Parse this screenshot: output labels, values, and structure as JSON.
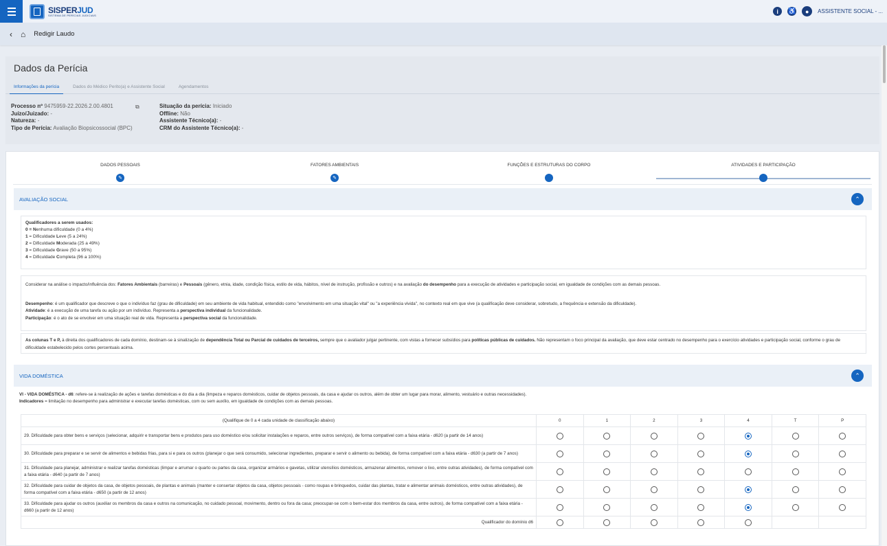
{
  "topbar": {
    "logo_main": "SISPER",
    "logo_accent": "JUD",
    "logo_sub": "SISTEMA DE PERÍCIAS JUDICIAIS",
    "info_icon": "i",
    "accessibility_icon": "accessibility-icon",
    "user_name": "ASSISTENTE SOCIAL - ..."
  },
  "breadcrumb": {
    "back_icon": "‹",
    "home_icon": "home-icon",
    "title": "Redigir Laudo"
  },
  "pericia": {
    "title": "Dados da Perícia",
    "tabs": [
      {
        "label": "Informações da perícia"
      },
      {
        "label": "Dados do Médico Perito(a) e Assistente Social"
      },
      {
        "label": "Agendamentos"
      }
    ],
    "left": {
      "processo_label": "Processo nº",
      "processo_value": "9475959-22.2026.2.00.4801",
      "juizo_label": "Juízo/Juizado:",
      "juizo_value": "-",
      "natureza_label": "Natureza:",
      "natureza_value": "-",
      "tipo_label": "Tipo de Perícia:",
      "tipo_value": "Avaliação Biopsicossocial (BPC)"
    },
    "right": {
      "situacao_label": "Situação da perícia:",
      "situacao_value": "Iniciado",
      "offline_label": "Offline:",
      "offline_value": "Não",
      "assistente_label": "Assistente Técnico(a):",
      "assistente_value": "-",
      "crm_label": "CRM do Assistente Técnico(a):",
      "crm_value": "-"
    }
  },
  "stepper": [
    {
      "label": "DADOS PESSOAIS",
      "icon": "edit-icon"
    },
    {
      "label": "FATORES AMBIENTAIS",
      "icon": "edit-icon"
    },
    {
      "label": "FUNÇÕES E ESTRUTURAS DO CORPO",
      "icon": "dot"
    },
    {
      "label": "ATIVIDADES E PARTICIPAÇÃO",
      "icon": "dot"
    }
  ],
  "avaliacao": {
    "title": "AVALIAÇÃO SOCIAL",
    "qual_head": "Qualificadores a serem usados:",
    "q0_num": "0 =",
    "q0_b": "N",
    "q0_rest": "enhuma dificuldade (0 a 4%)",
    "q1_num": "1",
    "q1_pre": " = Dificuldade ",
    "q1_b": "L",
    "q1_rest": "eve (5 a 24%)",
    "q2_num": "2",
    "q2_pre": " = Dificuldade ",
    "q2_b": "M",
    "q2_rest": "oderada (25 a 49%)",
    "q3_num": "3",
    "q3_pre": " = Dificuldade ",
    "q3_b": "G",
    "q3_rest": "rave (50 a 95%)",
    "q4_num": "4",
    "q4_pre": " = Dificuldade ",
    "q4_b": "C",
    "q4_rest": "ompleta (96 a 100%)",
    "note1_a": "Considerar na análise o impacto/influência dos: ",
    "note1_b1": "Fatores Ambientais",
    "note1_c": " (barreiras) e ",
    "note1_b2": "Pessoais",
    "note1_d": " (gênero, etnia, idade, condição física, estilo de vida, hábitos, nível de instrução, profissão e outros) e na avaliação ",
    "note1_b3": "do desempenho",
    "note1_e": " para a execução de atividades e participação social, em igualdade de condições com as demais pessoas.",
    "desemp_b": "Desempenho",
    "desemp_t": ": é um qualificador que descreve o que o indivíduo faz (grau de dificuldade) em seu ambiente de vida habitual, entendido como \"envolvimento em uma situação vital\" ou \"a experiência vivida\", no contexto real em que vive (a qualificação deve considerar, sobretudo, a frequência e extensão da dificuldade).",
    "ativ_b": "Atividade",
    "ativ_t": ": é a execução de uma tarefa ou ação por um indivíduo. Representa a ",
    "ativ_b2": "perspectiva individual",
    "ativ_t2": " da funcionalidade.",
    "part_b": "Participação",
    "part_t": ": é o ato de se envolver em uma situação real de vida. Representa a ",
    "part_b2": "perspectiva social",
    "part_t2": " da funcionalidade.",
    "col_b": "As colunas T e P,",
    "col_t": " à direita dos qualificadores de cada domínio, destinam-se à sinalização de ",
    "col_b2": "dependência Total ou Parcial de cuidados de terceiros,",
    "col_t2": " sempre que o avaliador julgar pertinente, com vistas a fornecer subsídios para ",
    "col_b3": "políticas públicas de cuidados.",
    "col_t3": " Não representam o foco principal da avaliação, que deve estar centrado no desempenho para o exercício atividades e participação social, conforme o grau de dificuldade estabelecido pelos cortes percentuais acima."
  },
  "vida": {
    "title": "VIDA DOMÉSTICA",
    "desc_b": "VI - VIDA DOMÉSTICA - d6",
    "desc_t": ": refere-se à realização de ações e tarefas domésticas e do dia a dia (limpeza e reparos domésticos, cuidar de objetos pessoais, da casa e ajudar os outros, além de obter um lugar para morar, alimento, vestuário e outras necessidades).",
    "ind_b": "Indicadores",
    "ind_t": " = limitação no desempenho para administrar e executar tarefas domésticas, com ou sem auxílio, em igualdade de condições com as demais pessoas.",
    "table_head": "(Qualifique de 0 a 4 cada unidade de classificação abaixo)",
    "columns": [
      "0",
      "1",
      "2",
      "3",
      "4",
      "T",
      "P"
    ],
    "rows": [
      {
        "text": "29. Dificuldade para obter bens e serviços (selecionar, adquirir e transportar bens e produtos para uso doméstico e/ou solicitar instalações e reparos, entre outros serviços), de forma compatível com a faixa etária - d620 (a partir de 14 anos)",
        "selected": "4"
      },
      {
        "text": "30. Dificuldade para preparar e se servir de alimentos e bebidas frias, para si e para os outros (planejar o que será consumido, selecionar ingredientes, preparar e servir o alimento ou bebida), de forma compatível com a faixa etária - d630 (a partir de 7 anos)",
        "selected": "4"
      },
      {
        "text": "31. Dificuldade para planejar, administrar e realizar tarefas domésticas (limpar e arrumar o quarto ou partes da casa, organizar armários e gavetas, utilizar utensílios domésticos, armazenar alimentos, remover o lixo, entre outras atividades), de forma compatível com a faixa etária - d640 (a partir de 7 anos)",
        "selected": ""
      },
      {
        "text": "32. Dificuldade para cuidar de objetos da casa, de objetos pessoais, de plantas e animais (manter e consertar objetos da casa, objetos pessoais - como roupas e brinquedos, cuidar das plantas, tratar e alimentar animais domésticos, entre outras atividades), de forma compatível com a faixa etária - d650 (a partir de 12 anos)",
        "selected": "4"
      },
      {
        "text": "33. Dificuldade para ajudar os outros (auxiliar os membros da casa e outros na comunicação, no cuidado pessoal, movimento, dentro ou fora da casa; preocupar-se com o bem-estar dos membros da casa, entre outros), de forma compatível com a faixa etária - d660 (a partir de 12 anos)",
        "selected": "4"
      }
    ],
    "domain_label": "Qualificador do domínio d6"
  },
  "colors": {
    "primary": "#1565c0",
    "header_bg": "#eef2f8",
    "section_bg": "#eaf0f7"
  }
}
